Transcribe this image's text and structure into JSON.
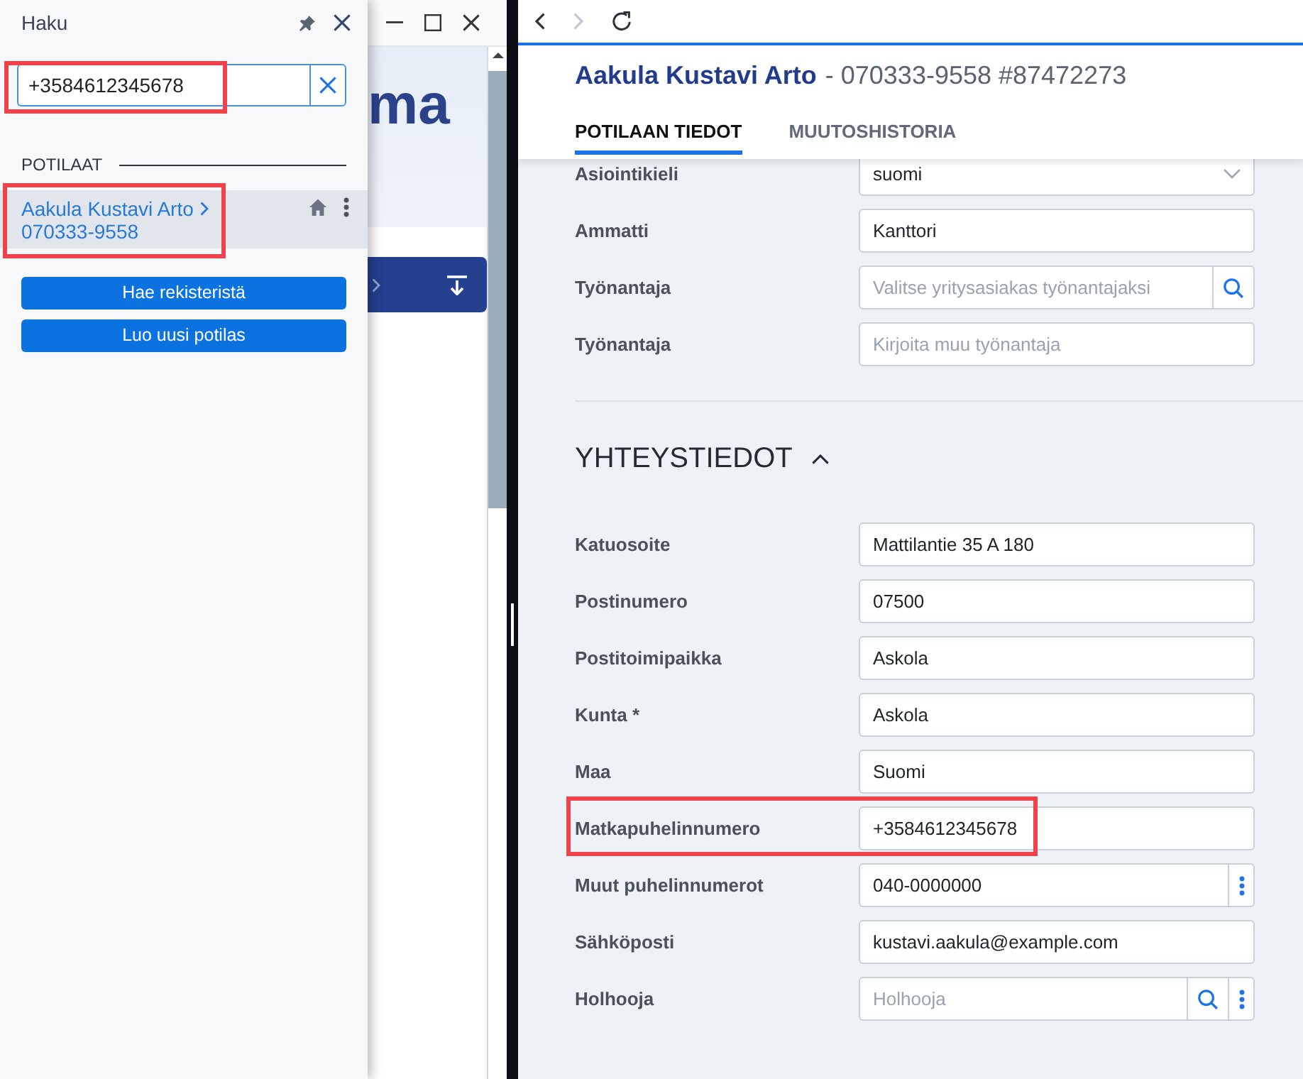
{
  "search_panel": {
    "title": "Haku",
    "search": {
      "value": "+3584612345678",
      "focused": true,
      "highlighted": true
    },
    "section_title": "POTILAAT",
    "patients": [
      {
        "name": "Aakula Kustavi Arto",
        "id": "070333-9558",
        "selected": true,
        "highlighted": true
      }
    ],
    "buttons": [
      "Hae rekisteristä",
      "Luo uusi potilas"
    ]
  },
  "background_window": {
    "heading": "ma"
  },
  "patient_window": {
    "nav_buttons": [
      {
        "kind": "back",
        "disabled": false
      },
      {
        "kind": "forward",
        "disabled": true
      },
      {
        "kind": "reload",
        "disabled": false
      }
    ],
    "title": {
      "name": "Aakula Kustavi Arto",
      "details": "- 070333-9558 #87472273"
    },
    "tabs": [
      {
        "label": "POTILAAN TIEDOT",
        "selected": true
      },
      {
        "label": "MUUTOSHISTORIA",
        "selected": false
      }
    ],
    "fields": [
      {
        "label": "Asiointikieli",
        "kind": "select",
        "value": "suomi",
        "highlighted": false
      },
      {
        "label": "Ammatti",
        "kind": "text",
        "value": "Kanttori",
        "highlighted": false
      },
      {
        "label": "Työnantaja",
        "kind": "lookup",
        "placeholder": "Valitse yritysasiakas työnantajaksi",
        "highlighted": false
      },
      {
        "label": "Työnantaja",
        "kind": "text",
        "placeholder": "Kirjoita muu työnantaja",
        "highlighted": false
      }
    ],
    "sections": [
      {
        "title": "YHTEYSTIEDOT",
        "expanded": true,
        "fields": [
          {
            "label": "Katuosoite",
            "kind": "text",
            "value": "Mattilantie 35 A 180",
            "highlighted": false
          },
          {
            "label": "Postinumero",
            "kind": "text",
            "value": "07500",
            "highlighted": false
          },
          {
            "label": "Postitoimipaikka",
            "kind": "text",
            "value": "Askola",
            "highlighted": false
          },
          {
            "label": "Kunta *",
            "kind": "text",
            "value": "Askola",
            "highlighted": false
          },
          {
            "label": "Maa",
            "kind": "text",
            "value": "Suomi",
            "highlighted": false
          },
          {
            "label": "Matkapuhelinnumero",
            "kind": "text",
            "value": "+3584612345678",
            "highlighted": true
          },
          {
            "label": "Muut puhelinnumerot",
            "kind": "multi",
            "value": "040-0000000",
            "highlighted": false
          },
          {
            "label": "Sähköposti",
            "kind": "text",
            "value": "kustavi.aakula@example.com",
            "highlighted": false
          },
          {
            "label": "Holhooja",
            "kind": "lookup_multi",
            "placeholder": "Holhooja",
            "highlighted": false
          }
        ]
      }
    ]
  }
}
